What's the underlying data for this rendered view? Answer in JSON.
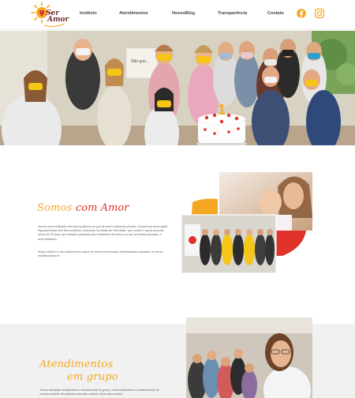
{
  "header": {
    "logo_text_line1": "Ser",
    "logo_text_line2": "Amor",
    "nav": [
      "Instituto",
      "Atendimentos",
      "NossoBlog",
      "Transparência",
      "Contato"
    ],
    "social_icons": [
      "facebook-icon",
      "instagram-icon"
    ],
    "accent_color": "#f5a623"
  },
  "hero": {
    "cake_number": "1",
    "sign_text": "Não gue..."
  },
  "somos": {
    "title_part1": "Somos",
    "title_part2": "com Amor",
    "para1": "Somos uma instituição sem fins lucrativos em prol de quem realmente precisa. Somos uma associação regulamentada sem fins lucrativos, localizada na cidade de Votorantim, que recebe e apoia pessoas acima de 30 anos, que estejam passando pelo tratamento de câncer ou que já tenham passado, e seus familiares.",
    "para2": "Nosso objetivo é dar acolhimento e apoio de forma humanizada, especializada e gratuita, em áreas multidisciplinares."
  },
  "atendimentos": {
    "title_line1": "Atendimentos",
    "title_line2": "em grupo",
    "para": "Temos atividades terapêuticas e educacionais em grupo, onde trabalhamos o fortalecimento de vínculos através de práticas corporais, cultura e lazer para nossos"
  },
  "colors": {
    "orange": "#f5a623",
    "red": "#e0312b",
    "grey_band": "#f1f1f1"
  }
}
